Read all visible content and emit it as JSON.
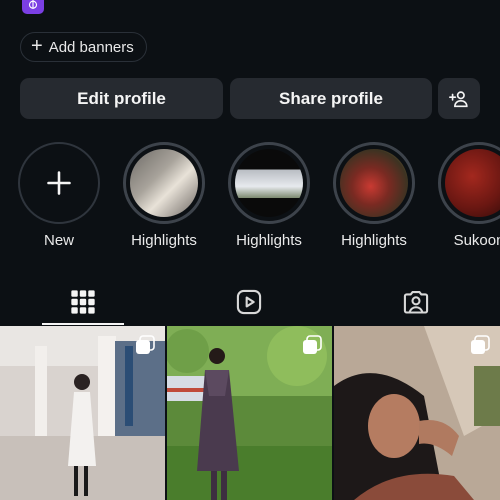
{
  "app_badge": {
    "icon": "khanda-icon",
    "color": "#7b3fe4"
  },
  "banner": {
    "label": "Add banners",
    "icon": "plus-icon"
  },
  "actions": {
    "edit_label": "Edit profile",
    "share_label": "Share profile",
    "add_icon": "add-person-icon"
  },
  "highlights": [
    {
      "label": "New",
      "type": "new"
    },
    {
      "label": "Highlights",
      "type": "photo"
    },
    {
      "label": "Highlights",
      "type": "photo"
    },
    {
      "label": "Highlights",
      "type": "photo"
    },
    {
      "label": "Sukoon",
      "type": "photo"
    }
  ],
  "tabs": [
    {
      "name": "posts-grid",
      "icon": "grid-icon",
      "active": true
    },
    {
      "name": "reels",
      "icon": "reels-icon",
      "active": false
    },
    {
      "name": "tagged",
      "icon": "tagged-person-icon",
      "active": false
    }
  ],
  "posts": [
    {
      "type": "multi",
      "icon": "carousel-icon"
    },
    {
      "type": "multi",
      "icon": "carousel-icon"
    },
    {
      "type": "multi",
      "icon": "carousel-icon"
    }
  ],
  "colors": {
    "background": "#0c1014",
    "button": "#262a30",
    "accent": "#7b3fe4"
  }
}
